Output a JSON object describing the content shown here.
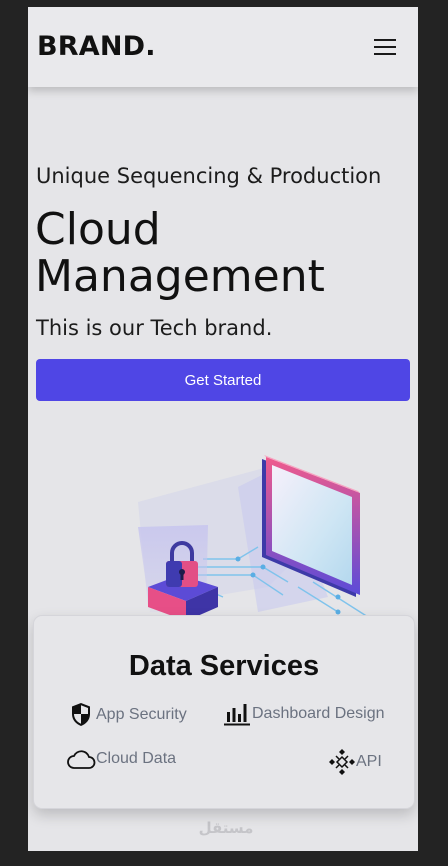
{
  "navbar": {
    "brand": "BRAND.",
    "menu_icon": "hamburger-icon"
  },
  "hero": {
    "eyebrow": "Unique Sequencing & Production",
    "title_line1": "Cloud",
    "title_line2": "Management",
    "subtitle": "This is our Tech brand.",
    "cta_label": "Get Started",
    "accent_color": "#4f46e5"
  },
  "illustration": {
    "icons": [
      "padlock-icon",
      "monitor-icon"
    ]
  },
  "services": {
    "title": "Data Services",
    "items": [
      {
        "label": "App Security",
        "icon": "shield-icon"
      },
      {
        "label": "Dashboard Design",
        "icon": "bar-chart-icon"
      },
      {
        "label": "Cloud Data",
        "icon": "cloud-icon"
      },
      {
        "label": "API",
        "icon": "api-icon"
      }
    ]
  },
  "footer": {
    "watermark": "مستقل"
  }
}
